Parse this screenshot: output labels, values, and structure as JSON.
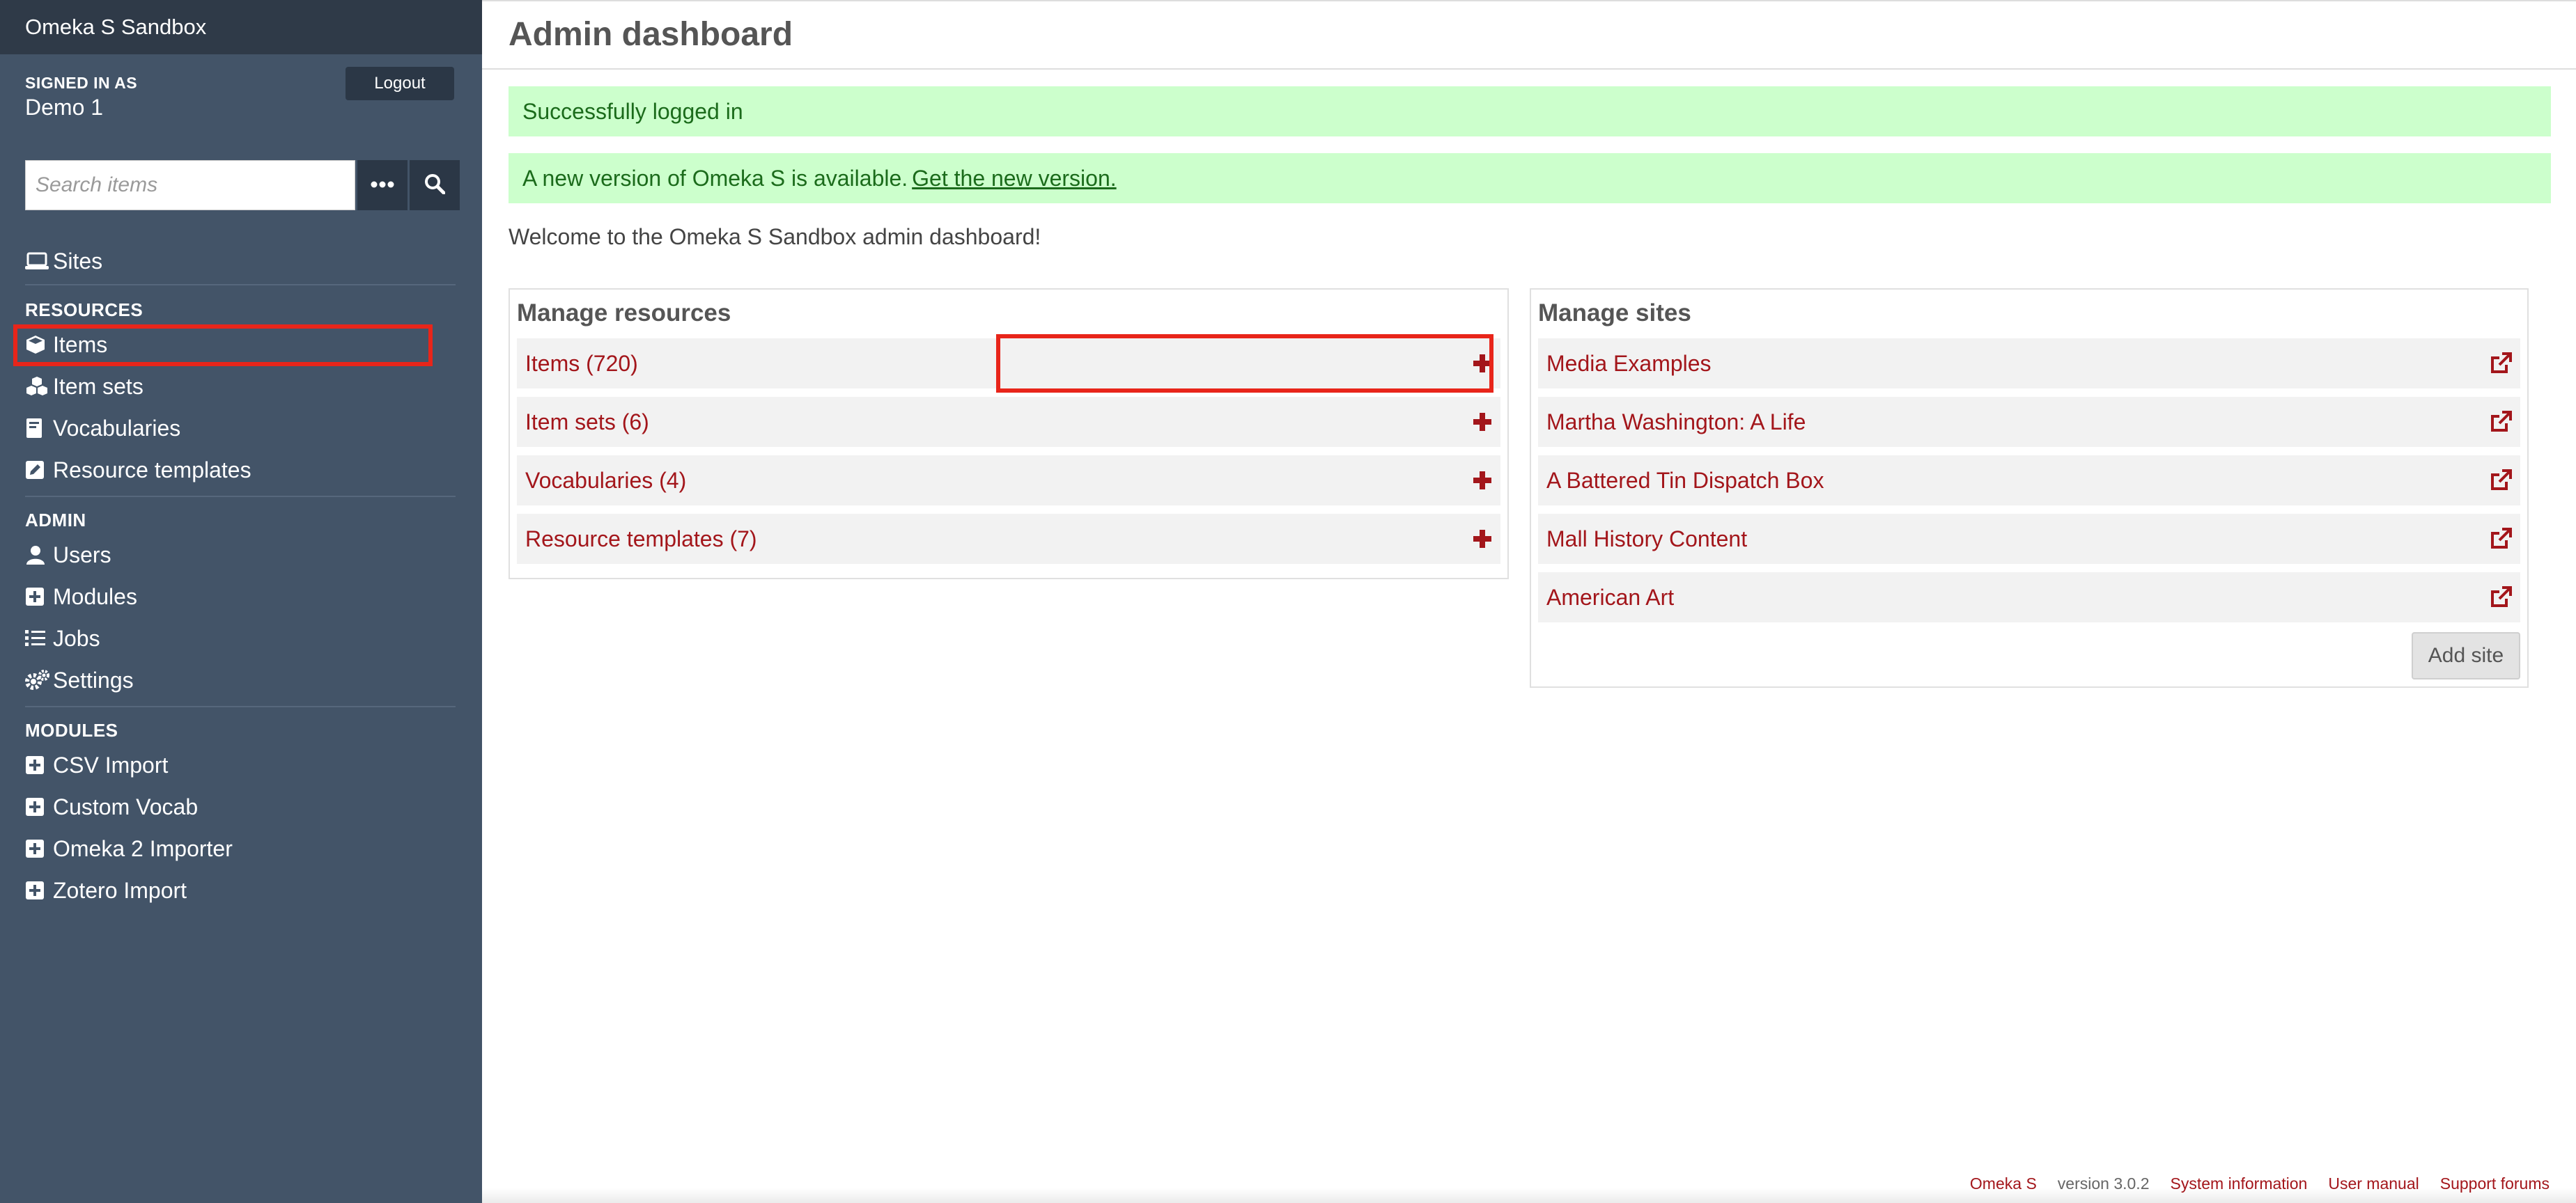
{
  "app": {
    "brand": "Omeka S Sandbox"
  },
  "user": {
    "signed_in_label": "SIGNED IN AS",
    "name": "Demo 1",
    "logout_label": "Logout"
  },
  "search": {
    "placeholder": "Search items"
  },
  "nav": {
    "sites": "Sites",
    "resources_title": "RESOURCES",
    "resources": [
      "Items",
      "Item sets",
      "Vocabularies",
      "Resource templates"
    ],
    "admin_title": "ADMIN",
    "admin": [
      "Users",
      "Modules",
      "Jobs",
      "Settings"
    ],
    "modules_title": "MODULES",
    "modules": [
      "CSV Import",
      "Custom Vocab",
      "Omeka 2 Importer",
      "Zotero Import"
    ]
  },
  "main": {
    "title": "Admin dashboard",
    "messages": {
      "login": "Successfully logged in",
      "update_text": "A new version of Omeka S is available.",
      "update_link": "Get the new version."
    },
    "welcome": "Welcome to the Omeka S Sandbox admin dashboard!",
    "manage_resources": {
      "title": "Manage resources",
      "rows": [
        "Items (720)",
        "Item sets (6)",
        "Vocabularies (4)",
        "Resource templates (7)"
      ]
    },
    "manage_sites": {
      "title": "Manage sites",
      "rows": [
        "Media Examples",
        "Martha Washington: A Life",
        "A Battered Tin Dispatch Box",
        "Mall History Content",
        "American Art"
      ],
      "add_label": "Add site"
    }
  },
  "footer": {
    "product": "Omeka S",
    "version": "version 3.0.2",
    "system_info": "System information",
    "manual": "User manual",
    "forums": "Support forums"
  },
  "colors": {
    "sidebar": "#435468",
    "brand_bar": "#2f3a48",
    "link": "#a3161b",
    "success_bg": "#ccffcc",
    "highlight": "#e8251a"
  }
}
